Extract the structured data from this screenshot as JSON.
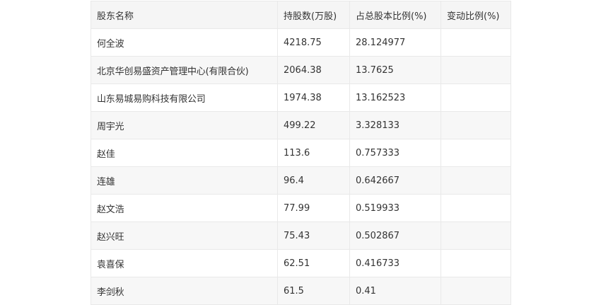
{
  "table": {
    "headers": [
      "股东名称",
      "持股数(万股)",
      "占总股本比例(%)",
      "变动比例(%)"
    ],
    "rows": [
      [
        "何全波",
        "4218.75",
        "28.124977",
        ""
      ],
      [
        "北京华创易盛资产管理中心(有限合伙)",
        "2064.38",
        "13.7625",
        ""
      ],
      [
        "山东易城易购科技有限公司",
        "1974.38",
        "13.162523",
        ""
      ],
      [
        "周宇光",
        "499.22",
        "3.328133",
        ""
      ],
      [
        "赵佳",
        "113.6",
        "0.757333",
        ""
      ],
      [
        "连雄",
        "96.4",
        "0.642667",
        ""
      ],
      [
        "赵文浩",
        "77.99",
        "0.519933",
        ""
      ],
      [
        "赵兴旺",
        "75.43",
        "0.502867",
        ""
      ],
      [
        "袁喜保",
        "62.51",
        "0.416733",
        ""
      ],
      [
        "李剑秋",
        "61.5",
        "0.41",
        ""
      ]
    ]
  }
}
